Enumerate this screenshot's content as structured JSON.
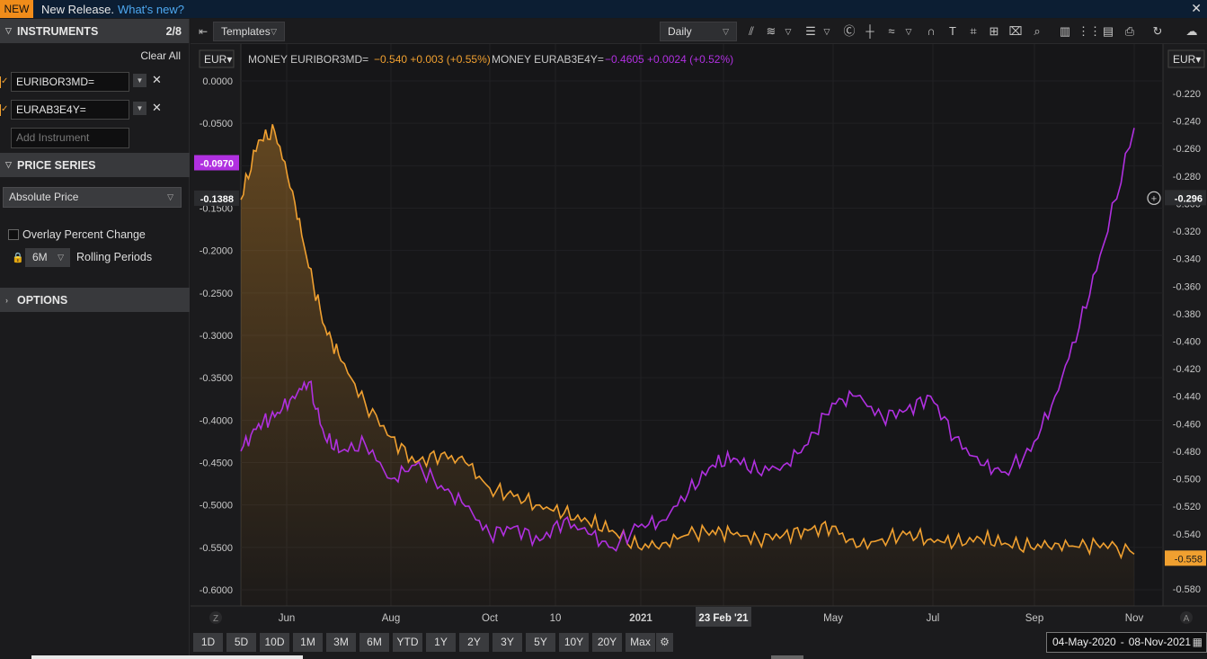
{
  "banner": {
    "new_label": "NEW",
    "text": "New Release.",
    "link": "What's new?",
    "close": "✕"
  },
  "sidebar": {
    "instruments_title": "INSTRUMENTS",
    "instruments_count": "2/8",
    "clear_all": "Clear All",
    "instruments": [
      {
        "ric": "EURIBOR3MD=",
        "color": "#f0a030"
      },
      {
        "ric": "EURAB3E4Y=",
        "color": "#f0a030"
      }
    ],
    "add_placeholder": "Add Instrument",
    "price_series_title": "PRICE SERIES",
    "price_type": "Absolute Price",
    "overlay_label": "Overlay Percent Change",
    "rolling_value": "6M",
    "rolling_label": "Rolling Periods",
    "options_title": "OPTIONS"
  },
  "toolbar": {
    "templates": "Templates",
    "interval": "Daily"
  },
  "chart_header": {
    "left_ccy": "EUR",
    "right_ccy": "EUR",
    "s1_label": "MONEY EURIBOR3MD=",
    "s1_values": "−0.540  +0.003 (+0.55%)",
    "s2_label": "MONEY EURAB3E4Y=",
    "s2_values": "−0.4605  +0.0024 (+0.52%)"
  },
  "bottom": {
    "ranges": [
      "1D",
      "5D",
      "10D",
      "1M",
      "3M",
      "6M",
      "YTD",
      "1Y",
      "2Y",
      "3Y",
      "5Y",
      "10Y",
      "20Y",
      "Max"
    ],
    "date_from": "04-May-2020",
    "date_sep": "-",
    "date_to": "08-Nov-2021",
    "zoom_left": "Z",
    "auto_right": "A"
  },
  "colors": {
    "orange": "#f0a030",
    "purple": "#b030e0",
    "bg": "#161618",
    "grid": "#232326"
  },
  "chart_data": {
    "type": "line",
    "x_ticks": [
      "Jun",
      "Aug",
      "Oct",
      "10",
      "2021",
      "23 Feb '21",
      "May",
      "Jul",
      "Sep",
      "Nov"
    ],
    "left_axis": {
      "ticks": [
        "0.0000",
        "-0.0500",
        "-0.1000",
        "-0.1500",
        "-0.2000",
        "-0.2500",
        "-0.3000",
        "-0.3500",
        "-0.4000",
        "-0.4500",
        "-0.5000",
        "-0.5500",
        "-0.6000"
      ],
      "ylim": [
        -0.62,
        0.01
      ]
    },
    "right_axis": {
      "ticks": [
        "-0.220",
        "-0.240",
        "-0.260",
        "-0.280",
        "-0.300",
        "-0.320",
        "-0.340",
        "-0.360",
        "-0.380",
        "-0.400",
        "-0.420",
        "-0.440",
        "-0.460",
        "-0.480",
        "-0.500",
        "-0.520",
        "-0.540",
        "-0.560",
        "-0.580"
      ],
      "ylim": [
        -0.591,
        -0.209
      ]
    },
    "markers": {
      "left_purple": "-0.0970",
      "left_white": "-0.1388",
      "right_cross": "-0.296",
      "right_orange": "-0.558"
    },
    "series": [
      {
        "name": "MONEY EURIBOR3MD=",
        "axis": "left",
        "color": "#f0a030",
        "x": [
          "04-May-2020",
          "15-May-2020",
          "25-May-2020",
          "05-Jun-2020",
          "15-Jun-2020",
          "25-Jun-2020",
          "05-Jul-2020",
          "20-Jul-2020",
          "05-Aug-2020",
          "20-Aug-2020",
          "05-Sep-2020",
          "20-Sep-2020",
          "05-Oct-2020",
          "20-Oct-2020",
          "05-Nov-2020",
          "20-Nov-2020",
          "05-Dec-2020",
          "20-Dec-2020",
          "05-Jan-2021",
          "20-Jan-2021",
          "05-Feb-2021",
          "20-Feb-2021",
          "05-Mar-2021",
          "20-Mar-2021",
          "05-Apr-2021",
          "20-Apr-2021",
          "05-May-2021",
          "20-May-2021",
          "05-Jun-2021",
          "20-Jun-2021",
          "05-Jul-2021",
          "20-Jul-2021",
          "05-Aug-2021",
          "20-Aug-2021",
          "05-Sep-2021",
          "20-Sep-2021",
          "05-Oct-2021",
          "20-Oct-2021",
          "08-Nov-2021"
        ],
        "values": [
          -0.14,
          -0.07,
          -0.06,
          -0.13,
          -0.22,
          -0.29,
          -0.33,
          -0.38,
          -0.42,
          -0.45,
          -0.44,
          -0.45,
          -0.48,
          -0.49,
          -0.5,
          -0.51,
          -0.52,
          -0.53,
          -0.55,
          -0.545,
          -0.535,
          -0.53,
          -0.535,
          -0.54,
          -0.535,
          -0.53,
          -0.525,
          -0.55,
          -0.54,
          -0.535,
          -0.54,
          -0.545,
          -0.54,
          -0.545,
          -0.55,
          -0.545,
          -0.55,
          -0.545,
          -0.558
        ]
      },
      {
        "name": "MONEY EURAB3E4Y=",
        "axis": "right",
        "color": "#b030e0",
        "x": [
          "04-May-2020",
          "15-May-2020",
          "25-May-2020",
          "05-Jun-2020",
          "15-Jun-2020",
          "25-Jun-2020",
          "05-Jul-2020",
          "20-Jul-2020",
          "05-Aug-2020",
          "20-Aug-2020",
          "05-Sep-2020",
          "20-Sep-2020",
          "05-Oct-2020",
          "20-Oct-2020",
          "05-Nov-2020",
          "20-Nov-2020",
          "05-Dec-2020",
          "20-Dec-2020",
          "05-Jan-2021",
          "20-Jan-2021",
          "05-Feb-2021",
          "20-Feb-2021",
          "05-Mar-2021",
          "20-Mar-2021",
          "05-Apr-2021",
          "20-Apr-2021",
          "05-May-2021",
          "20-May-2021",
          "05-Jun-2021",
          "20-Jun-2021",
          "05-Jul-2021",
          "20-Jul-2021",
          "05-Aug-2021",
          "20-Aug-2021",
          "05-Sep-2021",
          "20-Sep-2021",
          "05-Oct-2021",
          "20-Oct-2021",
          "08-Nov-2021"
        ],
        "values": [
          -0.48,
          -0.46,
          -0.455,
          -0.44,
          -0.43,
          -0.47,
          -0.48,
          -0.475,
          -0.5,
          -0.49,
          -0.505,
          -0.52,
          -0.54,
          -0.535,
          -0.545,
          -0.53,
          -0.54,
          -0.55,
          -0.535,
          -0.53,
          -0.51,
          -0.49,
          -0.485,
          -0.495,
          -0.49,
          -0.475,
          -0.445,
          -0.44,
          -0.455,
          -0.45,
          -0.44,
          -0.47,
          -0.49,
          -0.495,
          -0.48,
          -0.44,
          -0.39,
          -0.33,
          -0.245
        ]
      }
    ]
  }
}
